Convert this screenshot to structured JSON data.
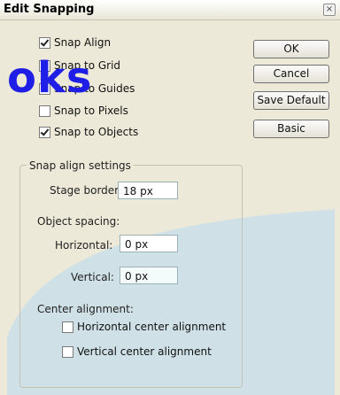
{
  "window": {
    "title": "Edit Snapping",
    "close_glyph": "×"
  },
  "snap_options": [
    {
      "label": "Snap Align",
      "checked": true
    },
    {
      "label": "Snap to Grid",
      "checked": false
    },
    {
      "label": "Snap to Guides",
      "checked": false
    },
    {
      "label": "Snap to Pixels",
      "checked": false
    },
    {
      "label": "Snap to Objects",
      "checked": true
    }
  ],
  "buttons": {
    "ok": "OK",
    "cancel": "Cancel",
    "save_default": "Save Default",
    "basic": "Basic"
  },
  "settings": {
    "legend": "Snap align settings",
    "stage_border_label": "Stage border:",
    "stage_border_value": "18 px",
    "object_spacing_label": "Object spacing:",
    "horizontal_label": "Horizontal:",
    "horizontal_value": "0 px",
    "vertical_label": "Vertical:",
    "vertical_value": "0 px",
    "center_alignment_label": "Center alignment:",
    "horizontal_center": {
      "label": "Horizontal center alignment",
      "checked": false
    },
    "vertical_center": {
      "label": "Vertical center alignment",
      "checked": false
    }
  },
  "watermark": "oks",
  "colors": {
    "watermark": "#1e1ee6",
    "swoosh": "#cfe1e7",
    "dialog_bg": "#ece9d8"
  }
}
